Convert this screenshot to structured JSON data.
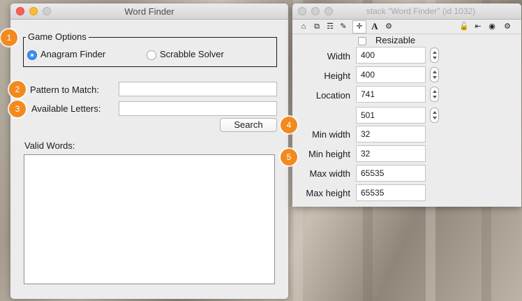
{
  "main_window": {
    "title": "Word Finder",
    "game_options_legend": "Game Options",
    "radio_anagram_label": "Anagram Finder",
    "radio_scrabble_label": "Scrabble Solver",
    "pattern_label": "Pattern to Match:",
    "pattern_value": "",
    "letters_label": "Available Letters:",
    "letters_value": "",
    "search_button": "Search",
    "valid_words_label": "Valid Words:",
    "valid_words_value": ""
  },
  "badges": [
    "1",
    "2",
    "3",
    "4",
    "5"
  ],
  "inspector": {
    "title": "stack \"Word Finder\" (id 1032)",
    "toolbar_icons": [
      "home-icon",
      "copy-icon",
      "database-icon",
      "pencil-icon",
      "move-icon",
      "text-icon",
      "gears-icon",
      "lock-icon",
      "exit-icon",
      "target-icon",
      "settings-icon"
    ],
    "resizable_label": "Resizable",
    "resizable_checked": false,
    "width_label": "Width",
    "width_value": "400",
    "height_label": "Height",
    "height_value": "400",
    "location_label": "Location",
    "location_x": "741",
    "location_y": "501",
    "min_width_label": "Min width",
    "min_width_value": "32",
    "min_height_label": "Min height",
    "min_height_value": "32",
    "max_width_label": "Max width",
    "max_width_value": "65535",
    "max_height_label": "Max height",
    "max_height_value": "65535"
  },
  "colors": {
    "accent": "#3f8ef5",
    "badge": "#f28a1f",
    "close": "#fc5f57",
    "minimize": "#fdbc2e"
  }
}
